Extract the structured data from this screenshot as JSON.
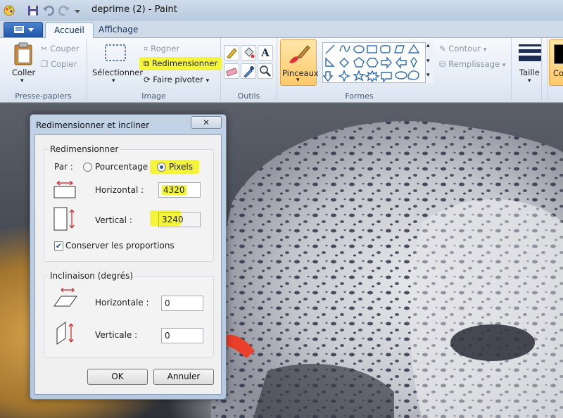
{
  "window": {
    "title": "deprime (2) - Paint"
  },
  "tabs": [
    {
      "label": "Accueil"
    },
    {
      "label": "Affichage"
    }
  ],
  "ribbon": {
    "clipboard": {
      "paste": "Coller",
      "cut": "Couper",
      "copy": "Copier",
      "group": "Presse-papiers"
    },
    "image": {
      "select": "Sélectionner",
      "crop": "Rogner",
      "resize": "Redimensionner",
      "rotate": "Faire pivoter",
      "group": "Image"
    },
    "tools": {
      "group": "Outils"
    },
    "brushes": {
      "label": "Pinceaux"
    },
    "shapes": {
      "outline": "Contour",
      "fill": "Remplissage",
      "group": "Formes"
    },
    "size": {
      "label": "Taille"
    },
    "colors": {
      "label": "Co"
    }
  },
  "dialog": {
    "title": "Redimensionner et incliner",
    "close": "✕",
    "resize": {
      "legend": "Redimensionner",
      "by_label": "Par :",
      "option_percent": "Pourcentage",
      "option_pixels": "Pixels",
      "selected": "pixels",
      "horizontal_label": "Horizontal :",
      "horizontal_value": "4320",
      "vertical_label": "Vertical :",
      "vertical_value": "3240",
      "keep_ratio": "Conserver les proportions",
      "keep_ratio_checked": true
    },
    "skew": {
      "legend": "Inclinaison (degrés)",
      "horizontal_label": "Horizontale :",
      "horizontal_value": "0",
      "vertical_label": "Verticale :",
      "vertical_value": "0"
    },
    "ok": "OK",
    "cancel": "Annuler"
  },
  "colors": {
    "highlight": "#f4f43c",
    "ribbon_bg": "#e3ebf5",
    "file_button": "#2a62b4"
  }
}
